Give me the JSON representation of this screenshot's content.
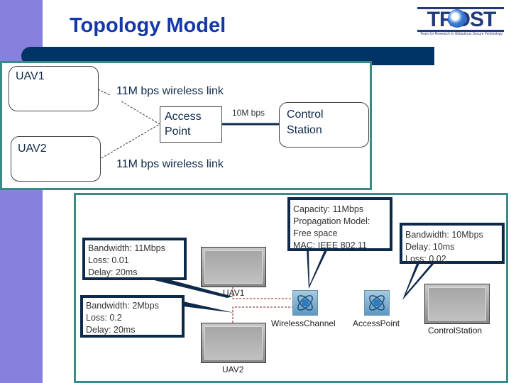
{
  "slide": {
    "title": "Topology Model",
    "logo": {
      "name": "TROST",
      "tagline": "Team for Research in Ubiquitous Secure Technology"
    }
  },
  "conceptual_diagram": {
    "nodes": {
      "uav1": "UAV1",
      "uav2": "UAV2",
      "access_point_line1": "Access",
      "access_point_line2": "Point",
      "control_station_line1": "Control",
      "control_station_line2": "Station"
    },
    "links": {
      "uav1_link": "11M bps wireless link",
      "uav2_link": "11M bps wireless link",
      "wired_link": "10M bps"
    }
  },
  "simulation_diagram": {
    "nodes": {
      "uav1": "UAV1",
      "uav2": "UAV2",
      "wireless_channel": "WirelessChannel",
      "access_point": "AccessPoint",
      "control_station": "ControlStation"
    },
    "callouts": {
      "uav1_link": [
        "Bandwidth: 11Mbps",
        "Loss: 0.01",
        "Delay: 20ms"
      ],
      "uav2_link": [
        "Bandwidth: 2Mbps",
        "Loss: 0.2",
        "Delay: 20ms"
      ],
      "wireless_channel": [
        "Capacity: 11Mbps",
        "Propagation Model:",
        "Free space",
        "MAC: IEEE 802.11"
      ],
      "wired_link": [
        "Bandwidth: 10Mbps",
        "Delay: 10ms",
        "Loss: 0.02"
      ]
    }
  },
  "colors": {
    "sidebar": "#8880de",
    "title": "#1438a8",
    "header_bar": "#003366",
    "panel_border": "#3b8a8a",
    "callout_border": "#0e2a4a",
    "sim_link": "#8b1a1a"
  }
}
